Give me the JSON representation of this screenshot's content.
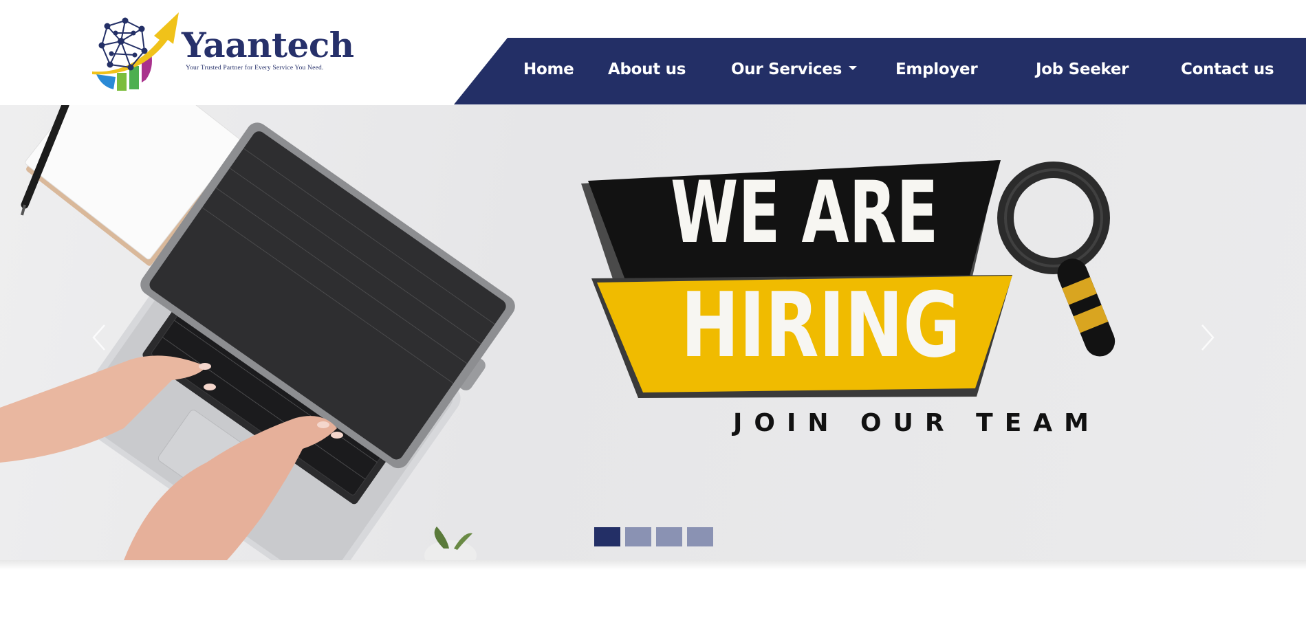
{
  "brand": {
    "name": "Yaantech",
    "tagline": "Your Trusted Partner for Every Service You Need."
  },
  "nav": {
    "items": [
      {
        "label": "Home"
      },
      {
        "label": "About us"
      },
      {
        "label": "Our Services"
      },
      {
        "label": "Employer"
      },
      {
        "label": "Job Seeker"
      },
      {
        "label": "Contact us"
      }
    ]
  },
  "hero": {
    "headline_1": "WE ARE",
    "headline_2": "HIRING",
    "subline": "JOIN OUR TEAM",
    "slide_count": 4,
    "active_slide": 1
  },
  "icons": {
    "prev": "chevron-left-icon",
    "next": "chevron-right-icon",
    "dropdown": "caret-down-icon",
    "search": "magnifier-icon"
  },
  "colors": {
    "navy": "#232f66",
    "yellow": "#f0bb00",
    "black": "#121212",
    "indicator_inactive": "#8a92b3"
  }
}
